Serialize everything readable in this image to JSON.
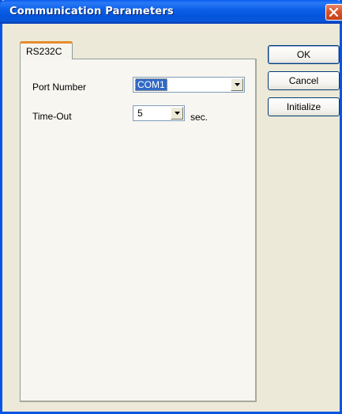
{
  "window": {
    "title": "Communication Parameters",
    "close_icon": "close-x-icon"
  },
  "tabs": [
    {
      "label": "RS232C",
      "active": true
    }
  ],
  "form": {
    "port_number": {
      "label": "Port Number",
      "value": "COM1"
    },
    "time_out": {
      "label": "Time-Out",
      "value": "5",
      "unit": "sec."
    }
  },
  "buttons": {
    "ok": "OK",
    "cancel": "Cancel",
    "initialize": "Initialize"
  },
  "colors": {
    "titlebar": "#0a5cf0",
    "selection": "#316ac5",
    "dialog_bg": "#ece9d8",
    "close": "#d9542a"
  }
}
